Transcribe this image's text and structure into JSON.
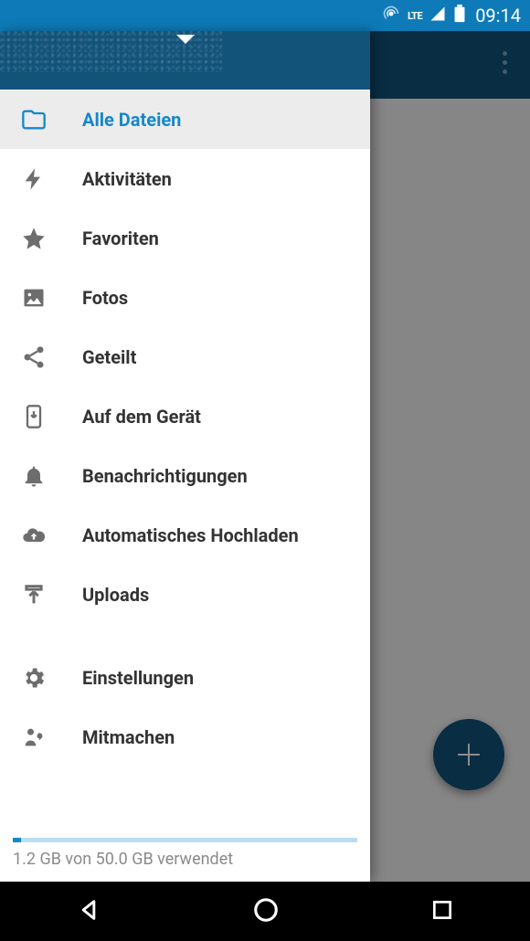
{
  "status": {
    "network_label": "LTE",
    "time": "09:14"
  },
  "drawer": {
    "items": [
      {
        "label": "Alle Dateien",
        "icon": "folder-outline-icon",
        "selected": true
      },
      {
        "label": "Aktivitäten",
        "icon": "bolt-icon",
        "selected": false
      },
      {
        "label": "Favoriten",
        "icon": "star-icon",
        "selected": false
      },
      {
        "label": "Fotos",
        "icon": "image-icon",
        "selected": false
      },
      {
        "label": "Geteilt",
        "icon": "share-icon",
        "selected": false
      },
      {
        "label": "Auf dem Gerät",
        "icon": "device-download-icon",
        "selected": false
      },
      {
        "label": "Benachrichtigungen",
        "icon": "bell-icon",
        "selected": false
      },
      {
        "label": "Automatisches Hochladen",
        "icon": "cloud-upload-icon",
        "selected": false
      },
      {
        "label": "Uploads",
        "icon": "upload-icon",
        "selected": false
      }
    ],
    "secondary": [
      {
        "label": "Einstellungen",
        "icon": "gear-icon"
      },
      {
        "label": "Mitmachen",
        "icon": "participate-icon"
      }
    ]
  },
  "storage": {
    "text": "1.2 GB von 50.0 GB verwendet",
    "used_gb": 1.2,
    "total_gb": 50.0,
    "percent": 2.4
  },
  "colors": {
    "accent": "#1588c9",
    "appbar": "#12537a"
  }
}
